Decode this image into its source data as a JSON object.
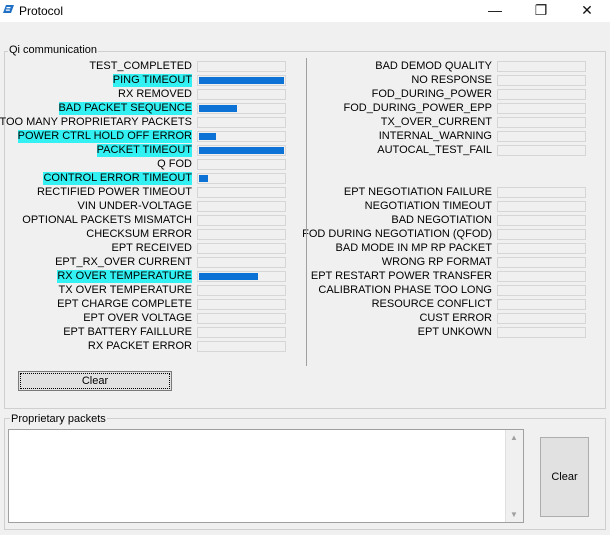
{
  "window": {
    "title": "Protocol",
    "minimize": "—",
    "maximize": "❐",
    "close": "✕"
  },
  "qi": {
    "group_label": "Qi communication",
    "left": [
      {
        "label": "TEST_COMPLETED",
        "highlighted": false,
        "value": 0
      },
      {
        "label": "PING TIMEOUT",
        "highlighted": true,
        "value": 1.0
      },
      {
        "label": "RX REMOVED",
        "highlighted": false,
        "value": 0
      },
      {
        "label": "BAD PACKET SEQUENCE",
        "highlighted": true,
        "value": 0.45
      },
      {
        "label": "TOO MANY PROPRIETARY PACKETS",
        "highlighted": false,
        "value": 0
      },
      {
        "label": "POWER CTRL HOLD OFF ERROR",
        "highlighted": true,
        "value": 0.2
      },
      {
        "label": "PACKET TIMEOUT",
        "highlighted": true,
        "value": 1.0
      },
      {
        "label": "Q FOD",
        "highlighted": false,
        "value": 0
      },
      {
        "label": "CONTROL ERROR TIMEOUT",
        "highlighted": true,
        "value": 0.1
      },
      {
        "label": "RECTIFIED POWER TIMEOUT",
        "highlighted": false,
        "value": 0
      },
      {
        "label": "VIN UNDER-VOLTAGE",
        "highlighted": false,
        "value": 0
      },
      {
        "label": "OPTIONAL PACKETS MISMATCH",
        "highlighted": false,
        "value": 0
      },
      {
        "label": "CHECKSUM ERROR",
        "highlighted": false,
        "value": 0
      },
      {
        "label": "EPT RECEIVED",
        "highlighted": false,
        "value": 0
      },
      {
        "label": "EPT_RX_OVER CURRENT",
        "highlighted": false,
        "value": 0
      },
      {
        "label": "RX OVER TEMPERATURE",
        "highlighted": true,
        "value": 0.7
      },
      {
        "label": "TX OVER TEMPERATURE",
        "highlighted": false,
        "value": 0
      },
      {
        "label": "EPT CHARGE COMPLETE",
        "highlighted": false,
        "value": 0
      },
      {
        "label": "EPT OVER VOLTAGE",
        "highlighted": false,
        "value": 0
      },
      {
        "label": "EPT BATTERY FAILLURE",
        "highlighted": false,
        "value": 0
      },
      {
        "label": "RX PACKET ERROR",
        "highlighted": false,
        "value": 0
      }
    ],
    "right_top": [
      {
        "label": "BAD DEMOD QUALITY",
        "value": 0
      },
      {
        "label": "NO RESPONSE",
        "value": 0
      },
      {
        "label": "FOD_DURING_POWER",
        "value": 0
      },
      {
        "label": "FOD_DURING_POWER_EPP",
        "value": 0
      },
      {
        "label": "TX_OVER_CURRENT",
        "value": 0
      },
      {
        "label": "INTERNAL_WARNING",
        "value": 0
      },
      {
        "label": "AUTOCAL_TEST_FAIL",
        "value": 0
      }
    ],
    "right_bottom": [
      {
        "label": "EPT NEGOTIATION FAILURE",
        "value": 0
      },
      {
        "label": "NEGOTIATION TIMEOUT",
        "value": 0
      },
      {
        "label": "BAD NEGOTIATION",
        "value": 0
      },
      {
        "label": "FOD DURING NEGOTIATION (QFOD)",
        "value": 0
      },
      {
        "label": "BAD MODE IN MP RP PACKET",
        "value": 0
      },
      {
        "label": "WRONG RP FORMAT",
        "value": 0
      },
      {
        "label": "EPT RESTART POWER TRANSFER",
        "value": 0
      },
      {
        "label": "CALIBRATION PHASE TOO LONG",
        "value": 0
      },
      {
        "label": "RESOURCE CONFLICT",
        "value": 0
      },
      {
        "label": "CUST ERROR",
        "value": 0
      },
      {
        "label": "EPT UNKOWN",
        "value": 0
      }
    ],
    "clear_label": "Clear"
  },
  "proprietary": {
    "group_label": "Proprietary packets",
    "text": "",
    "clear_label": "Clear"
  },
  "colors": {
    "highlight": "#33f0f2",
    "bar_fill": "#0d72d6"
  }
}
